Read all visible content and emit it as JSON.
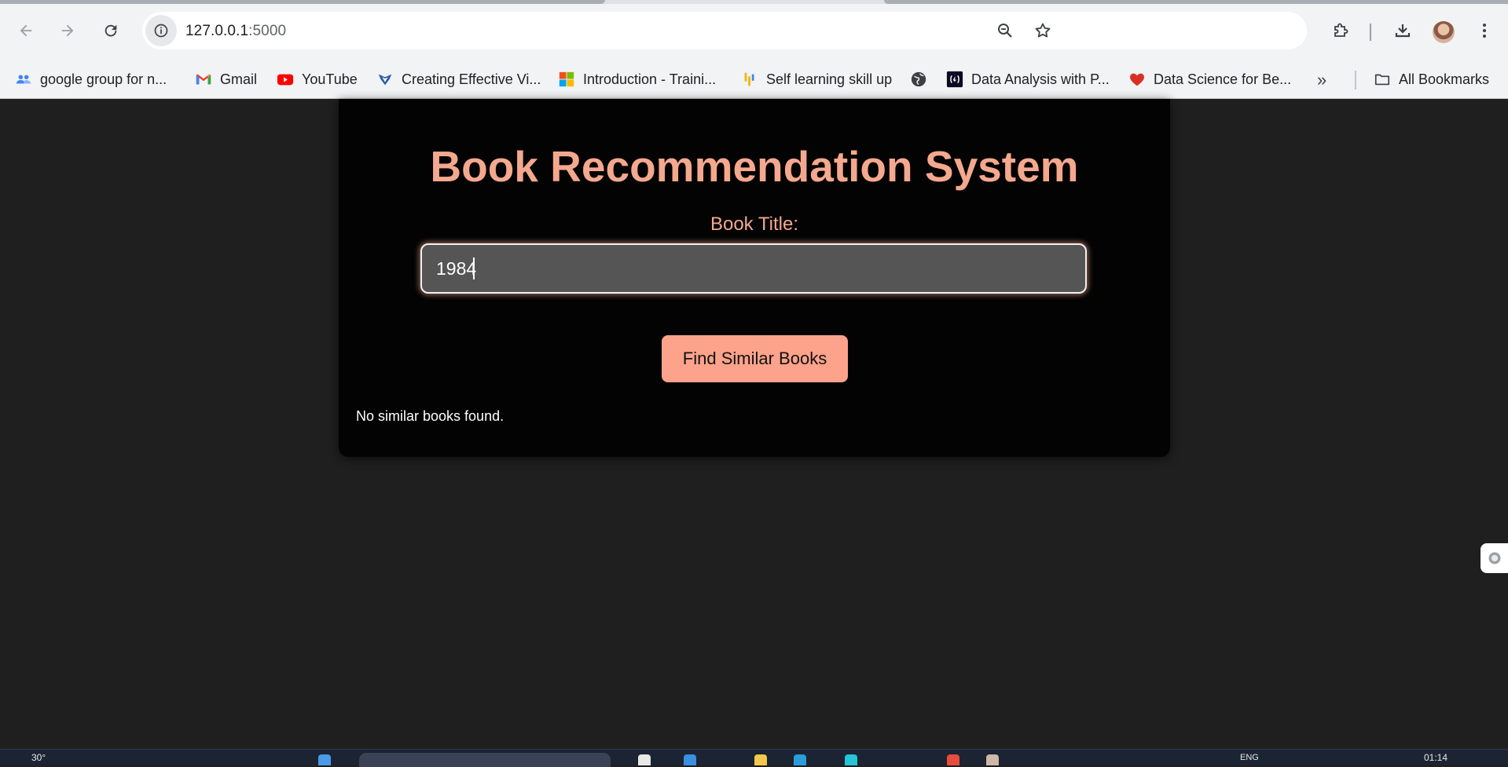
{
  "browser": {
    "url_host": "127.0.0.1",
    "url_port": ":5000",
    "bookmarks": [
      {
        "label": "google group for n...",
        "icon": "google-groups-icon"
      },
      {
        "label": "Gmail",
        "icon": "gmail-icon"
      },
      {
        "label": "YouTube",
        "icon": "youtube-icon"
      },
      {
        "label": "Creating Effective Vi...",
        "icon": "bookmark-site-icon"
      },
      {
        "label": "Introduction - Traini...",
        "icon": "microsoft-icon"
      },
      {
        "label": "Self learning skill up",
        "icon": "bars-logo-icon"
      },
      {
        "label": "",
        "icon": "globe-icon"
      },
      {
        "label": "Data Analysis with P...",
        "icon": "freecodecamp-icon"
      },
      {
        "label": "Data Science for Be...",
        "icon": "heart-icon"
      }
    ],
    "more_bookmarks": "»",
    "all_bookmarks_label": "All Bookmarks"
  },
  "page": {
    "title": "Book Recommendation System",
    "field_label": "Book Title:",
    "input_value": "1984",
    "button_label": "Find Similar Books",
    "result_message": "No similar books found."
  },
  "taskbar": {
    "weather": "30°",
    "language": "ENG",
    "clock": "01:14"
  },
  "colors": {
    "accent": "#f4a88e",
    "button": "#fda28b",
    "card_bg": "#030303",
    "page_bg": "#1f1f1f",
    "input_bg": "#555555"
  }
}
